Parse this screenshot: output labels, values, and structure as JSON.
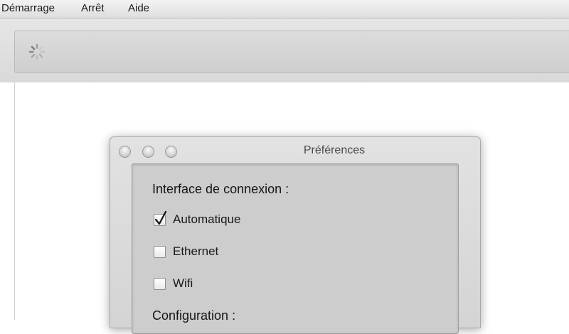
{
  "menubar": {
    "items": [
      {
        "label": "Démarrage"
      },
      {
        "label": "Arrêt"
      },
      {
        "label": "Aide"
      }
    ]
  },
  "toolbar": {
    "spinner_icon": "loading-spinner-icon"
  },
  "dialog": {
    "title": "Préférences",
    "connection_section": {
      "heading": "Interface de connexion :",
      "options": [
        {
          "label": "Automatique",
          "checked": true
        },
        {
          "label": "Ethernet",
          "checked": false
        },
        {
          "label": "Wifi",
          "checked": false
        }
      ]
    },
    "config_section": {
      "heading": "Configuration :"
    }
  }
}
